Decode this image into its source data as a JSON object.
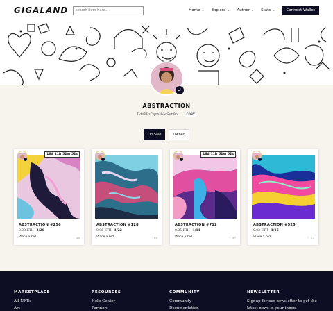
{
  "header": {
    "logo": "GIGALAND",
    "search_placeholder": "search item here...",
    "nav": [
      "Home",
      "Explore",
      "Author",
      "Stats"
    ],
    "connect_label": "Connect Wallet"
  },
  "profile": {
    "name": "ABSTRACTION",
    "wallet": "DdzFFzCqrhshMSxb9o...",
    "copy_label": "COPY"
  },
  "tabs": [
    "On Sale",
    "Owned"
  ],
  "cards": [
    {
      "title": "ABSTRACTION #256",
      "price": "0.08 ETH",
      "qty": "1/20",
      "bid": "Place a bid",
      "likes": "50",
      "timer": [
        "16d",
        "11h",
        "52m",
        "52s"
      ]
    },
    {
      "title": "ABSTRACTION #128",
      "price": "0.06 ETH",
      "qty": "1/22",
      "bid": "Place a bid",
      "likes": "80",
      "timer": null
    },
    {
      "title": "ABSTRACTION #712",
      "price": "0.05 ETH",
      "qty": "1/11",
      "bid": "Place a bid",
      "likes": "97",
      "timer": [
        "16d",
        "11h",
        "52m",
        "52s"
      ]
    },
    {
      "title": "ABSTRACTION #525",
      "price": "0.02 ETH",
      "qty": "1/15",
      "bid": "Place a bid",
      "likes": "73",
      "timer": null
    }
  ],
  "footer": {
    "columns": [
      {
        "title": "MARKETPLACE",
        "links": [
          "All NFTs",
          "Art"
        ]
      },
      {
        "title": "RESOURCES",
        "links": [
          "Help Center",
          "Partners"
        ]
      },
      {
        "title": "COMMUNITY",
        "links": [
          "Community",
          "Documentation"
        ]
      },
      {
        "title": "NEWSLETTER",
        "links": [
          "Signup for our newsletter to get the",
          "latest news in your inbox."
        ]
      }
    ]
  },
  "colors": {
    "navy": "#0d0d24",
    "background": "#f7f4ee"
  }
}
